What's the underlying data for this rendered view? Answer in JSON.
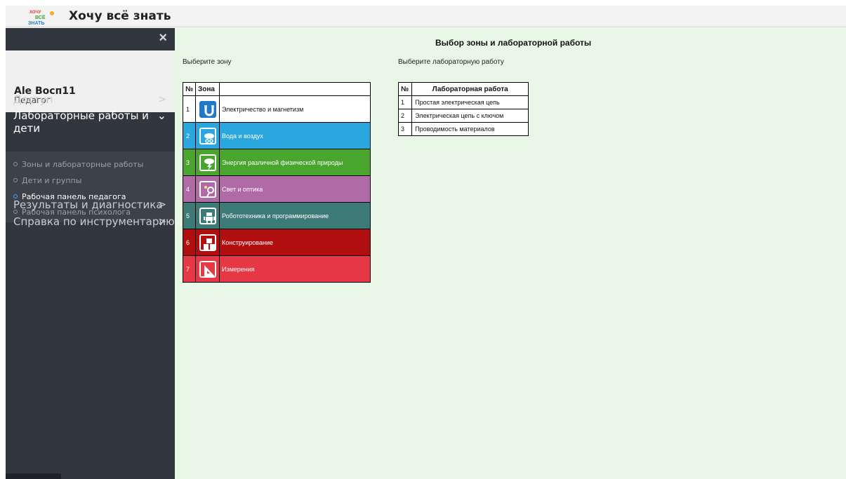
{
  "app": {
    "title": "Хочу всё знать",
    "logo_text": "Хочу всё знать"
  },
  "sidebar": {
    "close_label": "×",
    "user": {
      "name": "Ale Восп11",
      "role": "Педагог"
    },
    "menu": [
      {
        "label": "Доступ",
        "chevron": ">"
      },
      {
        "label": "Лабораторные работы и дети",
        "chevron": "⌄"
      },
      {
        "label": "Результаты и диагностика",
        "chevron": ">"
      },
      {
        "label": "Справка по инструментарию",
        "chevron": ">"
      }
    ],
    "submenu": [
      {
        "label": "Зоны и лабораторные работы"
      },
      {
        "label": "Дети и группы"
      },
      {
        "label": "Рабочая панель педагога",
        "active": true
      },
      {
        "label": "Рабочая панель психолога"
      }
    ]
  },
  "main": {
    "title": "Выбор зоны и лабораторной работы",
    "zone_prompt": "Выберите зону",
    "lab_prompt": "Выберите лабораторную работу",
    "zones_table": {
      "headers": [
        "№",
        "Зона"
      ],
      "rows": [
        {
          "num": "1",
          "name": "Электричество и магнетизм",
          "icon": "magnet-icon",
          "color": "#ffffff"
        },
        {
          "num": "2",
          "name": "Вода и воздух",
          "icon": "cloud-water-icon",
          "color": "#2aa7df"
        },
        {
          "num": "3",
          "name": "Энергия различной физической природы",
          "icon": "lightning-cloud-icon",
          "color": "#4aa52f"
        },
        {
          "num": "4",
          "name": "Свет и оптика",
          "icon": "magnifier-sun-icon",
          "color": "#b06aa6"
        },
        {
          "num": "5",
          "name": "Робототехника и программирование",
          "icon": "robot-icon",
          "color": "#3c7a78"
        },
        {
          "num": "6",
          "name": "Конструирование",
          "icon": "blocks-icon",
          "color": "#b10f0f"
        },
        {
          "num": "7",
          "name": "Измерения",
          "icon": "triangle-ruler-icon",
          "color": "#e63744"
        }
      ]
    },
    "labs_table": {
      "headers": [
        "№",
        "Лабораторная работа"
      ],
      "rows": [
        {
          "num": "1",
          "name": "Простая электрическая цепь"
        },
        {
          "num": "2",
          "name": "Электрическая цепь с ключом"
        },
        {
          "num": "3",
          "name": "Проводимость материалов"
        }
      ]
    }
  }
}
